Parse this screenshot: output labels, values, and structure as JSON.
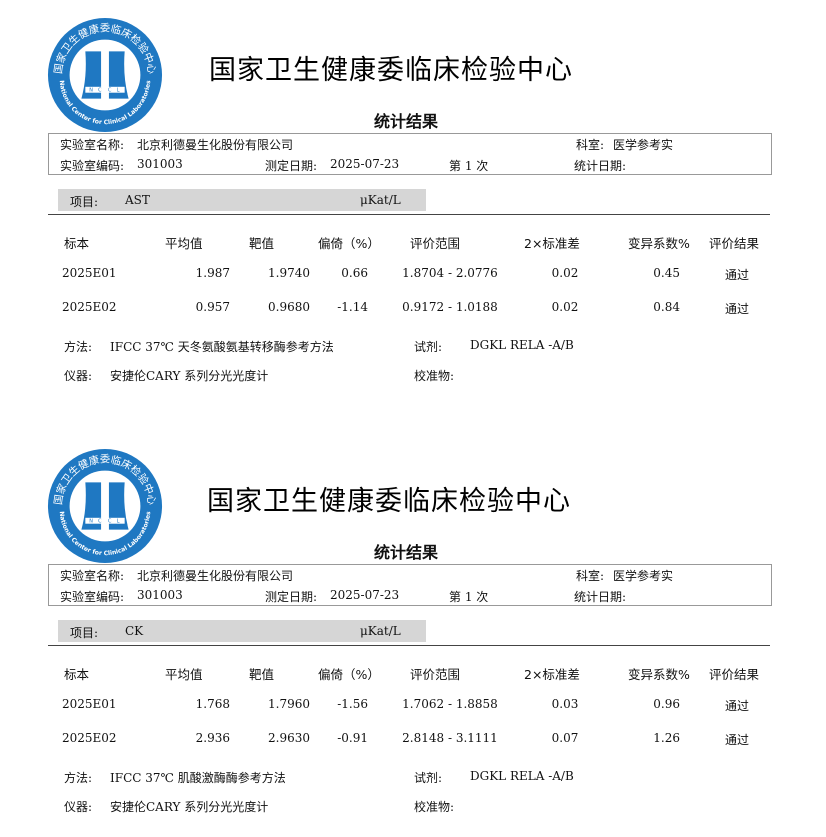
{
  "reports": [
    {
      "org_name": "国家卫生健康委临床检验中心",
      "subtitle": "统计结果",
      "lab_name_label": "实验室名称:",
      "lab_name": "北京利德曼生化股份有限公司",
      "department_label": "科室:",
      "department": "医学参考实",
      "lab_code_label": "实验室编码:",
      "lab_code": "301003",
      "test_date_label": "测定日期:",
      "test_date": "2025-07-23",
      "round": "第 1 次",
      "stat_date_label": "统计日期:",
      "stat_date": "",
      "item_label": "项目:",
      "item": "AST",
      "unit": "μKat/L",
      "headers": [
        "标本",
        "平均值",
        "靶值",
        "偏倚（%）",
        "评价范围",
        "2×标准差",
        "变异系数%",
        "评价结果"
      ],
      "rows": [
        {
          "sample": "2025E01",
          "mean": "1.987",
          "target": "1.9740",
          "bias": "0.66",
          "range": "1.8704 - 2.0776",
          "sd2": "0.02",
          "cv": "0.45",
          "result": "通过"
        },
        {
          "sample": "2025E02",
          "mean": "0.957",
          "target": "0.9680",
          "bias": "-1.14",
          "range": "0.9172 - 1.0188",
          "sd2": "0.02",
          "cv": "0.84",
          "result": "通过"
        }
      ],
      "method_label": "方法:",
      "method": "IFCC 37℃ 天冬氨酸氨基转移酶参考方法",
      "reagent_label": "试剂:",
      "reagent": "DGKL RELA -A/B",
      "instrument_label": "仪器:",
      "instrument": "安捷伦CARY 系列分光光度计",
      "calibrator_label": "校准物:",
      "calibrator": ""
    },
    {
      "org_name": "国家卫生健康委临床检验中心",
      "subtitle": "统计结果",
      "lab_name_label": "实验室名称:",
      "lab_name": "北京利德曼生化股份有限公司",
      "department_label": "科室:",
      "department": "医学参考实",
      "lab_code_label": "实验室编码:",
      "lab_code": "301003",
      "test_date_label": "测定日期:",
      "test_date": "2025-07-23",
      "round": "第 1 次",
      "stat_date_label": "统计日期:",
      "stat_date": "",
      "item_label": "项目:",
      "item": "CK",
      "unit": "μKat/L",
      "headers": [
        "标本",
        "平均值",
        "靶值",
        "偏倚（%）",
        "评价范围",
        "2×标准差",
        "变异系数%",
        "评价结果"
      ],
      "rows": [
        {
          "sample": "2025E01",
          "mean": "1.768",
          "target": "1.7960",
          "bias": "-1.56",
          "range": "1.7062 - 1.8858",
          "sd2": "0.03",
          "cv": "0.96",
          "result": "通过"
        },
        {
          "sample": "2025E02",
          "mean": "2.936",
          "target": "2.9630",
          "bias": "-0.91",
          "range": "2.8148 - 3.1111",
          "sd2": "0.07",
          "cv": "1.26",
          "result": "通过"
        }
      ],
      "method_label": "方法:",
      "method": "IFCC 37℃ 肌酸激酶酶参考方法",
      "reagent_label": "试剂:",
      "reagent": "DGKL RELA -A/B",
      "instrument_label": "仪器:",
      "instrument": "安捷伦CARY 系列分光光度计",
      "calibrator_label": "校准物:",
      "calibrator": ""
    }
  ],
  "logo": {
    "ring_text": "国家卫生健康委临床检验中心",
    "english_text": "National Center for Clinical Laboratories",
    "letters": [
      "N",
      "C",
      "C",
      "L"
    ],
    "color_blue": "#1f78c2",
    "color_light": "#ffffff"
  }
}
